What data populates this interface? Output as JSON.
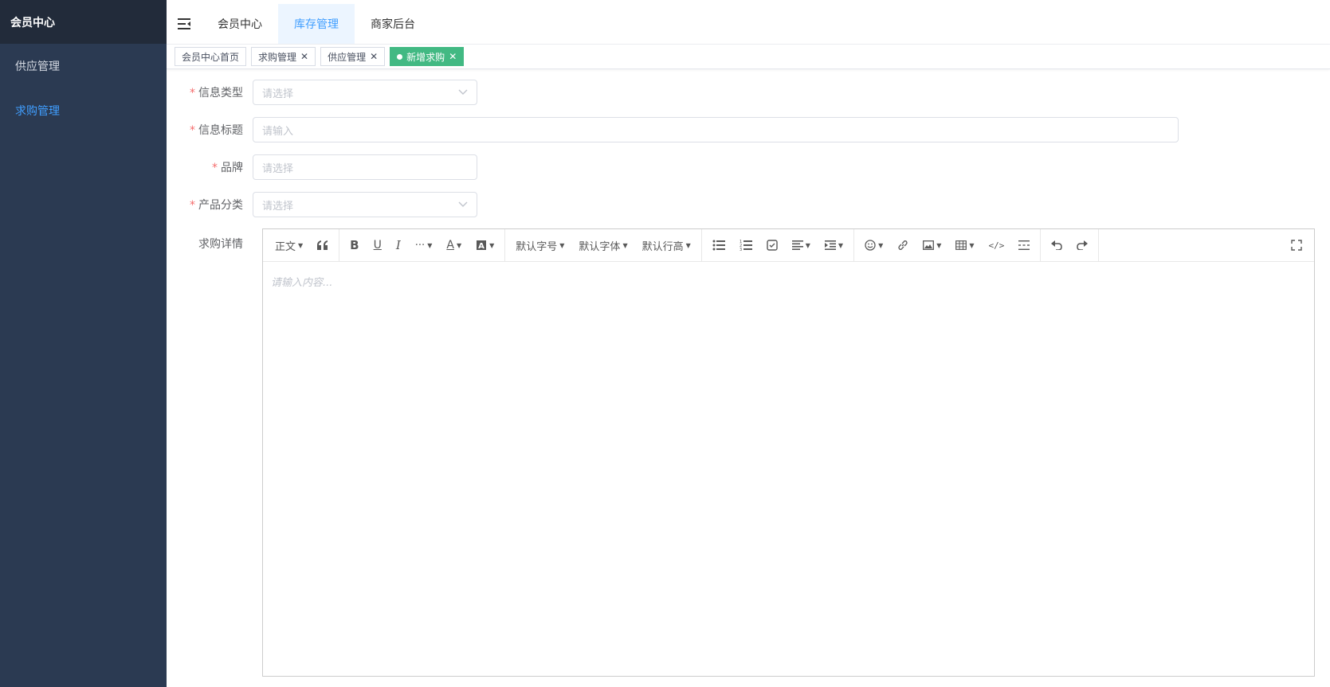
{
  "sidebar": {
    "title": "会员中心",
    "items": [
      {
        "label": "供应管理",
        "active": false
      },
      {
        "label": "求购管理",
        "active": true
      }
    ]
  },
  "topbar": {
    "menu_icon": "menu-fold-icon",
    "tabs": [
      {
        "label": "会员中心",
        "active": false
      },
      {
        "label": "库存管理",
        "active": true
      },
      {
        "label": "商家后台",
        "active": false
      }
    ]
  },
  "tags": [
    {
      "label": "会员中心首页",
      "closable": false,
      "active": false
    },
    {
      "label": "求购管理",
      "closable": true,
      "active": false
    },
    {
      "label": "供应管理",
      "closable": true,
      "active": false
    },
    {
      "label": "新增求购",
      "closable": true,
      "active": true
    }
  ],
  "form": {
    "info_type": {
      "label": "信息类型",
      "required": true,
      "placeholder": "请选择"
    },
    "info_title": {
      "label": "信息标题",
      "required": true,
      "placeholder": "请输入"
    },
    "brand": {
      "label": "品牌",
      "required": true,
      "placeholder": "请选择"
    },
    "category": {
      "label": "产品分类",
      "required": true,
      "placeholder": "请选择"
    },
    "detail": {
      "label": "求购详情",
      "required": false
    }
  },
  "editor": {
    "toolbar": {
      "paragraph": "正文",
      "font_size": "默认字号",
      "font_family": "默认字体",
      "line_height": "默认行高"
    },
    "placeholder": "请输入内容..."
  },
  "colors": {
    "sidebar_bg": "#2b3a52",
    "sidebar_head_bg": "#222b3a",
    "accent": "#409eff",
    "active_tag": "#42b983",
    "required": "#f56c6c"
  }
}
